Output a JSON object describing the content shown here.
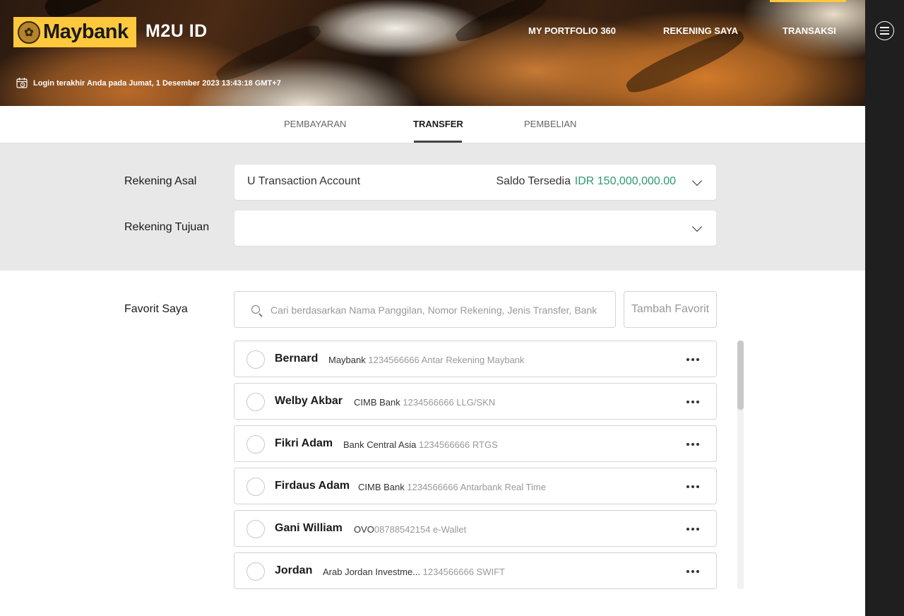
{
  "header": {
    "logo_text": "Maybank",
    "app_name": "M2U ID",
    "nav": [
      {
        "label": "MY PORTFOLIO 360"
      },
      {
        "label": "REKENING SAYA"
      },
      {
        "label": "TRANSAKSI",
        "active": true
      }
    ],
    "last_login": "Login terakhir Anda pada Jumat, 1 Desember 2023 13:43:18 GMT+7"
  },
  "tabs": [
    {
      "label": "PEMBAYARAN"
    },
    {
      "label": "TRANSFER",
      "active": true
    },
    {
      "label": "PEMBELIAN"
    }
  ],
  "form": {
    "source_label": "Rekening Asal",
    "source_account": "U Transaction Account",
    "balance_label": "Saldo Tersedia",
    "balance_value": "IDR 150,000,000.00",
    "destination_label": "Rekening Tujuan",
    "destination_value": ""
  },
  "favorites": {
    "label": "Favorit Saya",
    "search_placeholder": "Cari berdasarkan Nama Panggilan, Nomor Rekening, Jenis Transfer, Bank",
    "add_button": "Tambah Favorit",
    "items": [
      {
        "name": "Bernard",
        "bank": "Maybank",
        "meta": "1234566666 Antar Rekening Maybank"
      },
      {
        "name": "Welby Akbar",
        "bank": "CIMB Bank",
        "meta": "1234566666 LLG/SKN"
      },
      {
        "name": "Fikri Adam",
        "bank": "Bank Central Asia",
        "meta": "1234566666 RTGS"
      },
      {
        "name": "Firdaus Adam",
        "bank": "CIMB Bank",
        "meta": "1234566666 Antarbank Real Time"
      },
      {
        "name": "Gani William",
        "bank": "OVO",
        "meta": "08788542154 e-Wallet"
      },
      {
        "name": "Jordan",
        "bank": "Arab Jordan Investme...",
        "meta": "1234566666 SWIFT"
      }
    ]
  },
  "colors": {
    "brand_yellow": "#ffc83d",
    "balance_green": "#2e9a6e",
    "sidebar_dark": "#1f1f1f"
  }
}
